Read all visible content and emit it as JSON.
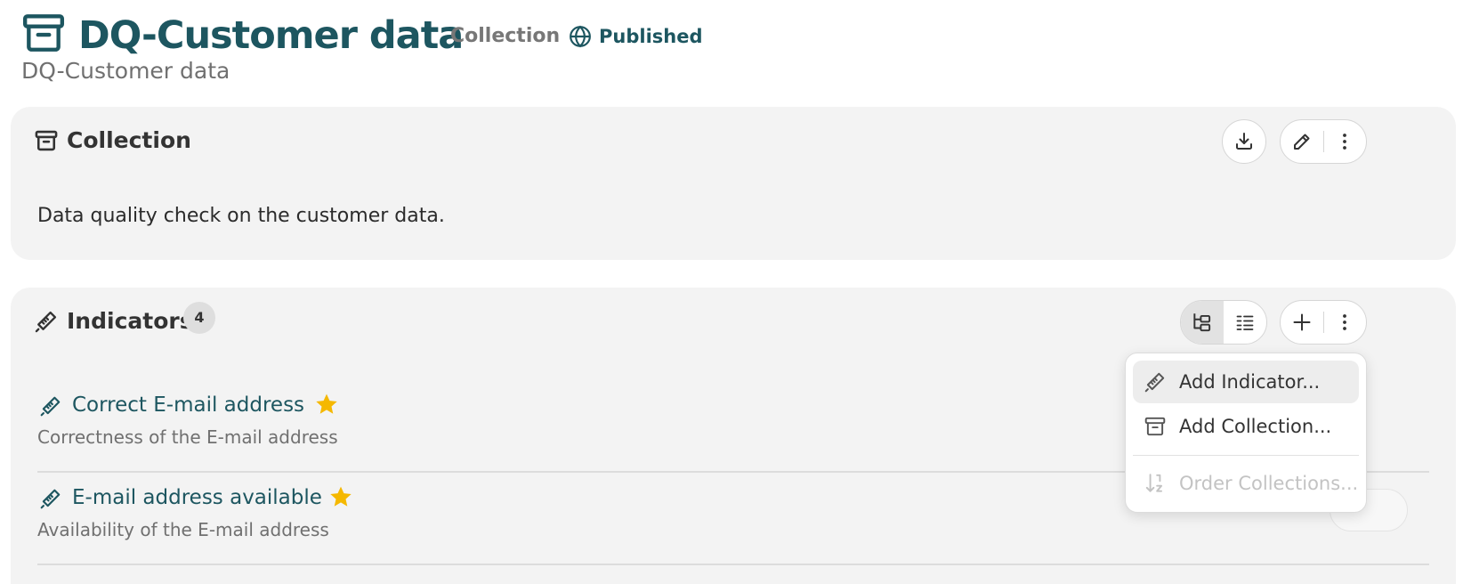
{
  "header": {
    "icon": "archive-box-icon",
    "title": "DQ-Customer data",
    "type_label": "Collection",
    "status_icon": "globe-icon",
    "status": "Published",
    "subtitle": "DQ-Customer data"
  },
  "collection_panel": {
    "icon": "archive-box-icon",
    "title": "Collection",
    "description": "Data quality check on the customer data.",
    "actions": [
      "download-icon",
      "pencil-icon",
      "more-vertical-icon"
    ]
  },
  "indicators_panel": {
    "icon": "thermometer-icon",
    "title": "Indicators",
    "count": "4",
    "view_modes": [
      "tree-view-icon",
      "list-view-icon"
    ],
    "active_view": "tree-view-icon",
    "actions": [
      "plus-icon",
      "more-vertical-icon"
    ],
    "items": [
      {
        "title": "Correct E-mail address",
        "description": "Correctness of the E-mail address",
        "favorite": true
      },
      {
        "title": "E-mail address available",
        "description": "Availability of the E-mail address",
        "favorite": true
      }
    ]
  },
  "dropdown_menu": {
    "items": [
      {
        "label": "Add Indicator...",
        "icon": "thermometer-icon",
        "enabled": true,
        "highlighted": true
      },
      {
        "label": "Add Collection...",
        "icon": "archive-box-icon",
        "enabled": true,
        "highlighted": false
      },
      {
        "label": "Order Collections...",
        "icon": "sort-order-icon",
        "enabled": false,
        "highlighted": false
      }
    ]
  },
  "colors": {
    "primary": "#1d5660",
    "panel_bg": "#f3f3f3",
    "star": "#f5b800",
    "muted_text": "#707070",
    "disabled_text": "#c3c3c3"
  }
}
